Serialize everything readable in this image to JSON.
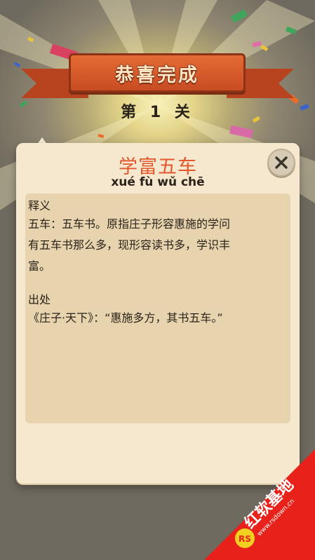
{
  "banner": {
    "title": "恭喜完成"
  },
  "level": {
    "label": "第 1 关"
  },
  "dialog": {
    "title": "学富五车",
    "pinyin": "xué fù wǔ chē",
    "close_label": "X",
    "definition": {
      "heading": "释义",
      "lines": [
        "五车：五车书。原指庄子形容惠施的学问",
        "有五车书那么多，现形容读书多，学识丰",
        "富。"
      ]
    },
    "source": {
      "heading": "出处",
      "lines": [
        "《庄子·天下》：“惠施多方，其书五车。”"
      ]
    }
  },
  "watermark": {
    "brand": "红软基地",
    "url": "www.rsdown.cn",
    "logo_text": "RS"
  },
  "colors": {
    "title_accent": "#e2572c",
    "banner_fill": "#d65a2a",
    "dialog_fill": "#f6e8cf",
    "content_fill": "#e7d3ad",
    "watermark_red": "#e8221a"
  }
}
